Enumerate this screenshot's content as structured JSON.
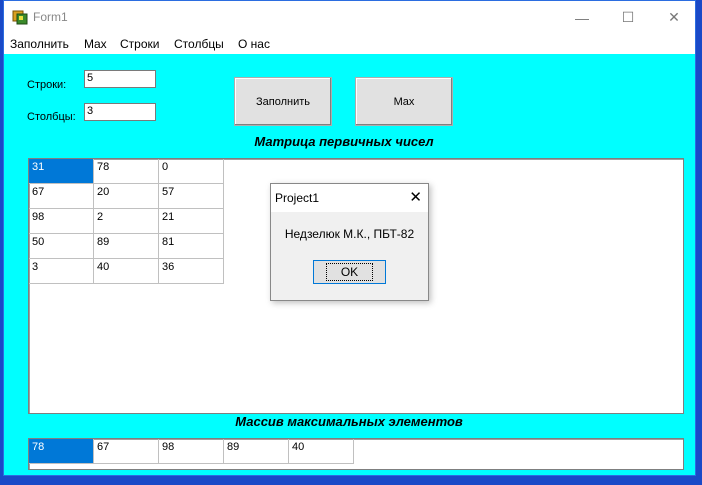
{
  "window": {
    "title": "Form1",
    "minimize": "—",
    "maximize": "☐",
    "close": "✕"
  },
  "menu": [
    "Заполнить",
    "Max",
    "Строки",
    "Столбцы",
    "О нас"
  ],
  "form": {
    "rows_label": "Строки:",
    "rows_value": "5",
    "cols_label": "Столбцы:",
    "cols_value": "3",
    "fill_button": "Заполнить",
    "max_button": "Max"
  },
  "matrix_caption": "Матрица первичных чисел",
  "matrix": [
    [
      "31",
      "78",
      "0"
    ],
    [
      "67",
      "20",
      "57"
    ],
    [
      "98",
      "2",
      "21"
    ],
    [
      "50",
      "89",
      "81"
    ],
    [
      "3",
      "40",
      "36"
    ]
  ],
  "max_caption": "Массив максимальных элементов",
  "max_array": [
    "78",
    "67",
    "98",
    "89",
    "40"
  ],
  "dialog": {
    "title": "Project1",
    "close": "✕",
    "message": "Недзелюк М.К., ПБТ-82",
    "ok": "OK"
  }
}
